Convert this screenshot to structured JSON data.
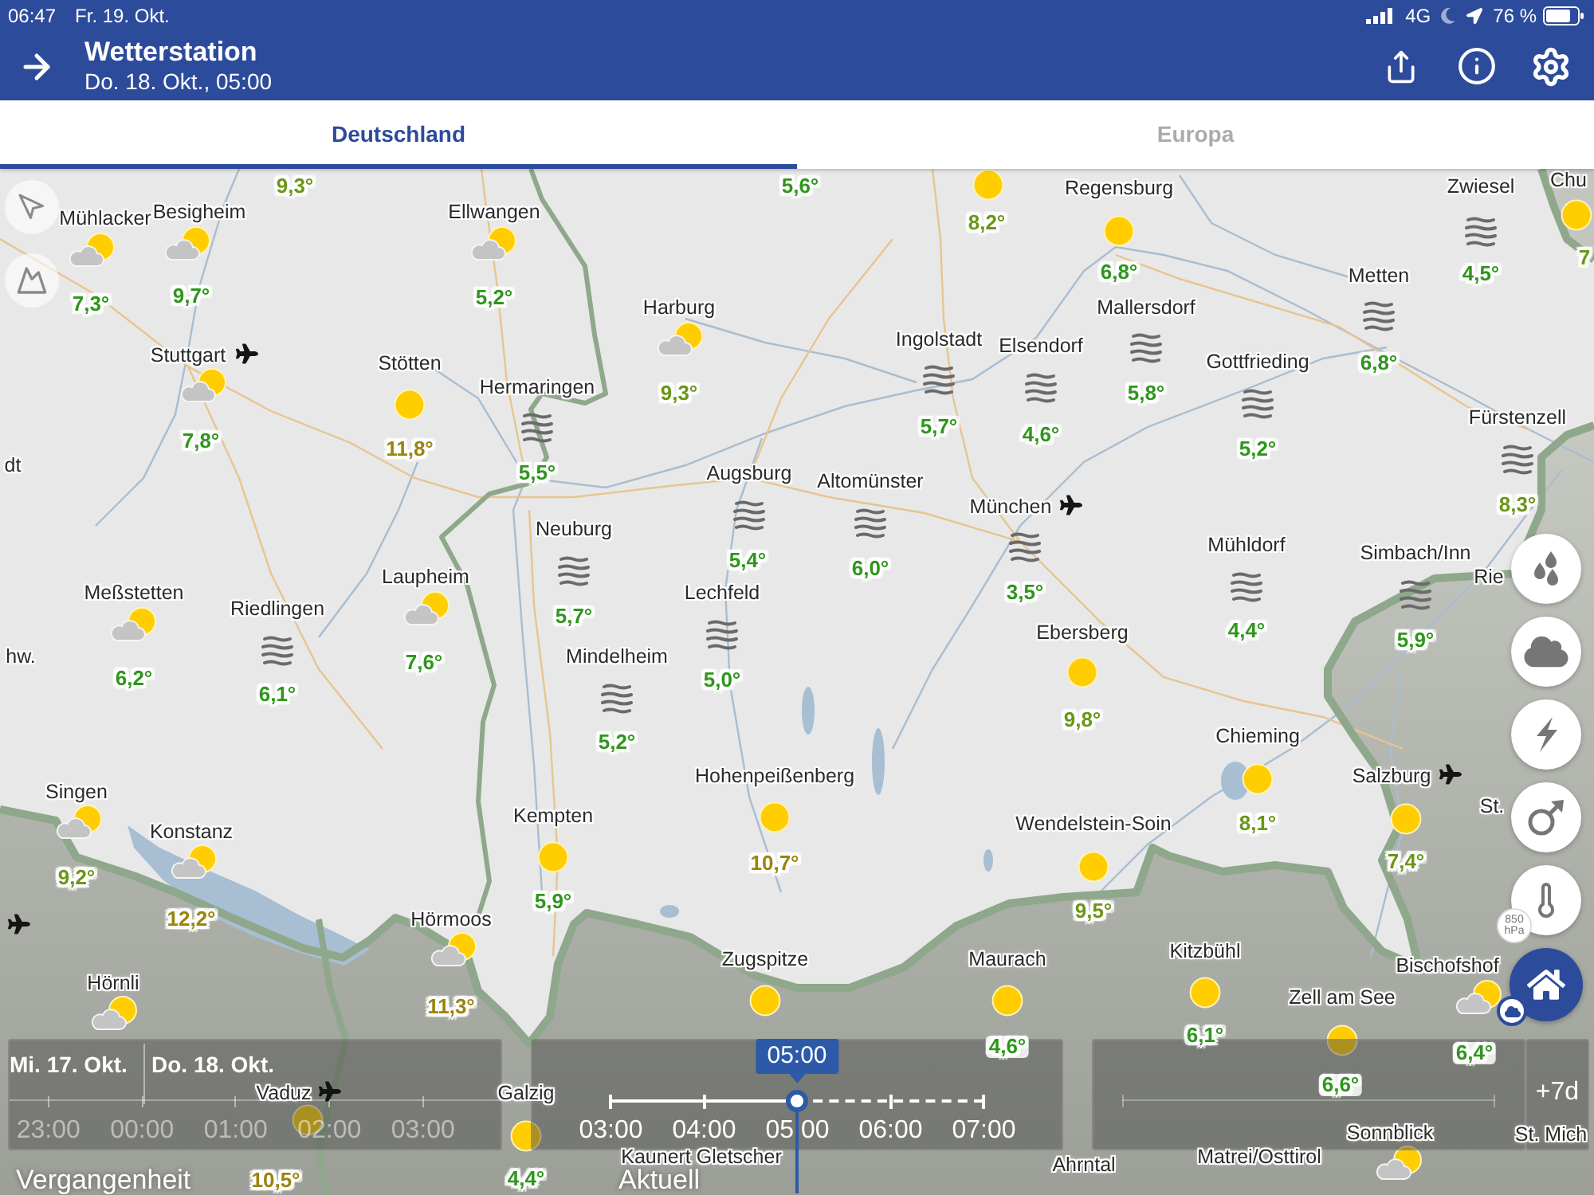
{
  "status_bar": {
    "time": "06:47",
    "date": "Fr. 19. Okt.",
    "network": "4G",
    "battery": "76 %"
  },
  "header": {
    "title": "Wetterstation",
    "subtitle": "Do. 18. Okt., 05:00"
  },
  "tabs": [
    {
      "label": "Deutschland",
      "selected": true
    },
    {
      "label": "Europa",
      "selected": false
    }
  ],
  "map": {
    "stations": [
      {
        "kind": "none",
        "temp": "9,3°",
        "color": "#6a9616",
        "airport": false
      },
      {
        "kind": "none",
        "temp": "5,6°",
        "color": "#2e961c",
        "airport": false
      },
      {
        "name": "Mühlacker",
        "kind": "partlycloudy",
        "temp": "7,3°",
        "color": "#2e961c",
        "airport": false
      },
      {
        "name": "Besigheim",
        "kind": "partlycloudy",
        "temp": "9,7°",
        "color": "#2e961c",
        "airport": false
      },
      {
        "name": "Ellwangen",
        "kind": "partlycloudy",
        "temp": "5,2°",
        "color": "#2e961c",
        "airport": false
      },
      {
        "kind": "sun",
        "temp": "8,2°",
        "color": "#6a9616",
        "airport": false
      },
      {
        "name": "Regensburg",
        "kind": "sun",
        "temp": "6,8°",
        "color": "#2e961c",
        "airport": false
      },
      {
        "name": "dt",
        "kind": "none",
        "airport": false
      },
      {
        "name": "Stuttgart",
        "kind": "partlycloudy",
        "temp": "7,8°",
        "color": "#2e961c",
        "airport": true
      },
      {
        "name": "Stötten",
        "kind": "sun",
        "temp": "11,8°",
        "color": "#9a8410",
        "airport": false
      },
      {
        "name": "Hermaringen",
        "kind": "fog",
        "temp": "5,5°",
        "color": "#2e961c",
        "airport": false
      },
      {
        "name": "Harburg",
        "kind": "partlycloudy",
        "temp": "9,3°",
        "color": "#6a9616",
        "airport": false
      },
      {
        "name": "Ingolstadt",
        "kind": "fog",
        "temp": "5,7°",
        "color": "#2e961c",
        "airport": false
      },
      {
        "name": "Elsendorf",
        "kind": "fog",
        "temp": "4,6°",
        "color": "#2e961c",
        "airport": false
      },
      {
        "name": "Mallersdorf",
        "kind": "fog",
        "temp": "5,8°",
        "color": "#2e961c",
        "airport": false
      },
      {
        "name": "Gottfrieding",
        "kind": "fog",
        "temp": "5,2°",
        "color": "#2e961c",
        "airport": false
      },
      {
        "name": "Metten",
        "kind": "fog",
        "temp": "6,8°",
        "color": "#2e961c",
        "airport": false
      },
      {
        "name": "Zwiesel",
        "kind": "fog",
        "temp": "4,5°",
        "color": "#2e961c",
        "airport": false
      },
      {
        "name": "Chu",
        "kind": "none",
        "airport": false
      },
      {
        "kind": "sun",
        "temp": "7",
        "color": "#6a9616",
        "airport": false
      },
      {
        "name": "hw.",
        "kind": "none",
        "airport": false
      },
      {
        "name": "Meßstetten",
        "kind": "partlycloudy",
        "temp": "6,2°",
        "color": "#2e961c",
        "airport": false
      },
      {
        "name": "Riedlingen",
        "kind": "fog",
        "temp": "6,1°",
        "color": "#2e961c",
        "airport": false
      },
      {
        "name": "Laupheim",
        "kind": "partlycloudy",
        "temp": "7,6°",
        "color": "#2e961c",
        "airport": false
      },
      {
        "name": "Neuburg",
        "kind": "fog",
        "temp": "5,7°",
        "color": "#2e961c",
        "airport": false
      },
      {
        "name": "Augsburg",
        "kind": "fog",
        "temp": "5,4°",
        "color": "#2e961c",
        "airport": false
      },
      {
        "name": "Mindelheim",
        "kind": "fog",
        "temp": "5,2°",
        "color": "#2e961c",
        "airport": false
      },
      {
        "name": "Lechfeld",
        "kind": "fog",
        "temp": "5,0°",
        "color": "#2e961c",
        "airport": false
      },
      {
        "name": "Altomünster",
        "kind": "fog",
        "temp": "6,0°",
        "color": "#2e961c",
        "airport": false
      },
      {
        "name": "München",
        "kind": "fog",
        "temp": "3,5°",
        "color": "#2e961c",
        "airport": true
      },
      {
        "name": "Fürstenzell",
        "kind": "fog",
        "temp": "8,3°",
        "color": "#6a9616",
        "airport": false
      },
      {
        "name": "Ebersberg",
        "kind": "sun",
        "temp": "9,8°",
        "color": "#6a9616",
        "airport": false
      },
      {
        "name": "Mühldorf",
        "kind": "fog",
        "temp": "4,4°",
        "color": "#2e961c",
        "airport": false
      },
      {
        "name": "Simbach/Inn",
        "kind": "fog",
        "temp": "5,9°",
        "color": "#2e961c",
        "airport": false
      },
      {
        "name": "Rie",
        "kind": "none",
        "airport": false
      },
      {
        "name": "Singen",
        "kind": "partlycloudy",
        "temp": "9,2°",
        "color": "#6a9616",
        "airport": false
      },
      {
        "kind": "none",
        "airport": true
      },
      {
        "name": "Konstanz",
        "kind": "partlycloudy",
        "temp": "12,2°",
        "color": "#9a8410",
        "airport": false
      },
      {
        "name": "Hörnli",
        "kind": "partlycloudy",
        "airport": false
      },
      {
        "name": "Hörmoos",
        "kind": "partlycloudy",
        "temp": "11,3°",
        "color": "#9a8410",
        "airport": false
      },
      {
        "name": "Kempten",
        "kind": "sun",
        "temp": "5,9°",
        "color": "#2e961c",
        "airport": false
      },
      {
        "name": "Hohenpeißenberg",
        "kind": "sun",
        "temp": "10,7°",
        "color": "#9a8410",
        "airport": false
      },
      {
        "name": "Wendelstein-Soin",
        "kind": "sun",
        "temp": "9,5°",
        "color": "#6a9616",
        "airport": false
      },
      {
        "name": "Chieming",
        "kind": "sun",
        "temp": "8,1°",
        "color": "#6a9616",
        "airport": false
      },
      {
        "name": "Salzburg",
        "kind": "sun",
        "temp": "7,4°",
        "color": "#6a9616",
        "airport": true
      },
      {
        "name": "St.",
        "kind": "none",
        "airport": false
      },
      {
        "name": "Zugspitze",
        "kind": "sun",
        "airport": false
      },
      {
        "name": "Maurach",
        "kind": "sun",
        "temp": "4,6°",
        "color": "#2e961c",
        "airport": false
      },
      {
        "name": "Kitzbühl",
        "kind": "sun",
        "temp": "6,1°",
        "color": "#2e961c",
        "airport": false
      },
      {
        "name": "Zell am See",
        "kind": "sun",
        "temp": "6,6°",
        "color": "#2e961c",
        "airport": false
      },
      {
        "name": "Bischofshof",
        "kind": "partlycloudy",
        "temp": "6,4°",
        "color": "#2e961c",
        "airport": false
      },
      {
        "name": "Vaduz",
        "kind": "sun",
        "temp": "10,5°",
        "color": "#9a8410",
        "airport": true
      },
      {
        "name": "Galzig",
        "kind": "sun",
        "temp": "4,4°",
        "color": "#2e961c",
        "airport": false
      },
      {
        "name": "Kaunert Gletscher",
        "kind": "none",
        "airport": false
      },
      {
        "name": "Ahrntal",
        "kind": "none",
        "airport": false
      },
      {
        "name": "Matrei/Osttirol",
        "kind": "none",
        "airport": false
      },
      {
        "name": "Sonnblick",
        "kind": "partlycloudy",
        "airport": false
      },
      {
        "name": "St. Mich",
        "kind": "none",
        "airport": false
      }
    ]
  },
  "layer_buttons": {
    "pressure_level": "850",
    "pressure_unit": "hPa"
  },
  "timeline": {
    "past": {
      "dates": [
        "Mi. 17. Okt.",
        "Do. 18. Okt."
      ],
      "times": [
        "23:00",
        "00:00",
        "01:00",
        "02:00",
        "03:00"
      ],
      "disabled": true,
      "label": "Vergangenheit"
    },
    "current": {
      "badge": "05:00",
      "times": [
        "03:00",
        "04:00",
        "05:00",
        "06:00",
        "07:00"
      ],
      "level": 0.5,
      "label": "Aktuell"
    },
    "future": {
      "label": "+7d"
    }
  }
}
